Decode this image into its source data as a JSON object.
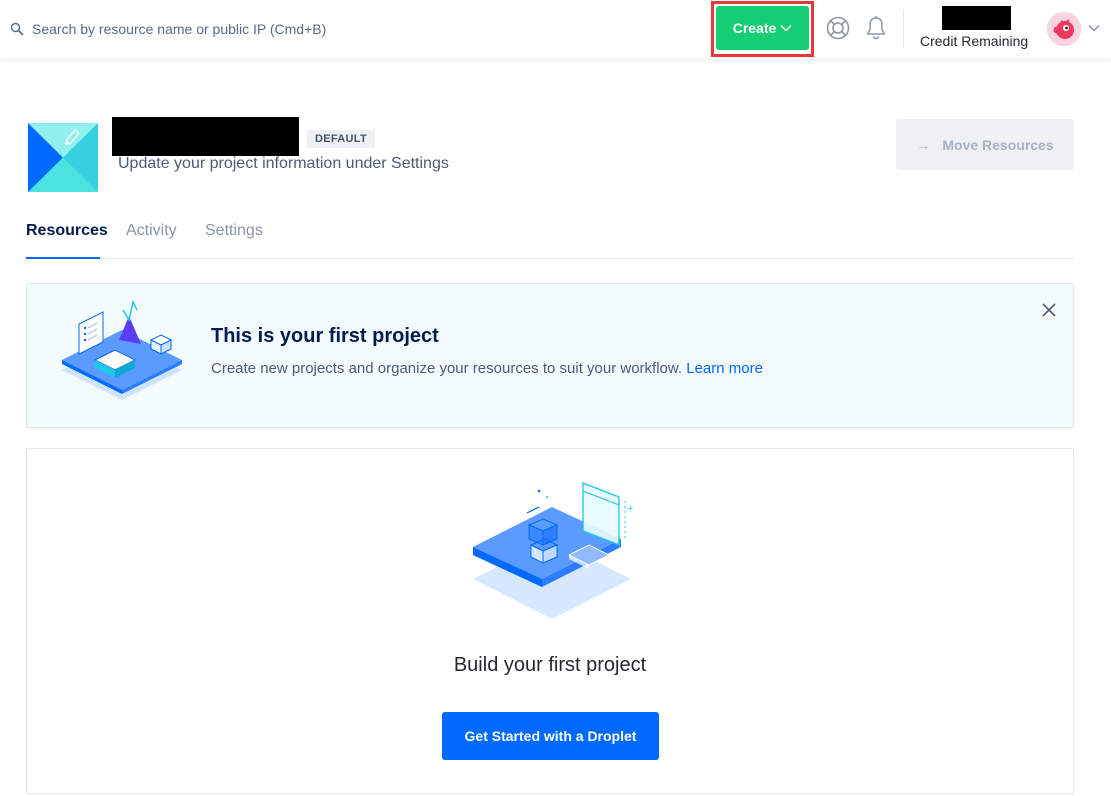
{
  "topbar": {
    "search_placeholder": "Search by resource name or public IP (Cmd+B)",
    "create_label": "Create",
    "credit_label": "Credit Remaining"
  },
  "project": {
    "badge": "DEFAULT",
    "subtitle": "Update your project information under Settings",
    "move_label": "Move Resources"
  },
  "tabs": [
    {
      "label": "Resources",
      "active": true
    },
    {
      "label": "Activity",
      "active": false
    },
    {
      "label": "Settings",
      "active": false
    }
  ],
  "banner": {
    "title": "This is your first project",
    "text": "Create new projects and organize your resources to suit your workflow.",
    "link": "Learn more"
  },
  "empty_state": {
    "title": "Build your first project",
    "button": "Get Started with a Droplet"
  },
  "colors": {
    "accent_green": "#15cd72",
    "accent_blue": "#0069ff",
    "highlight_red": "#e53935"
  }
}
